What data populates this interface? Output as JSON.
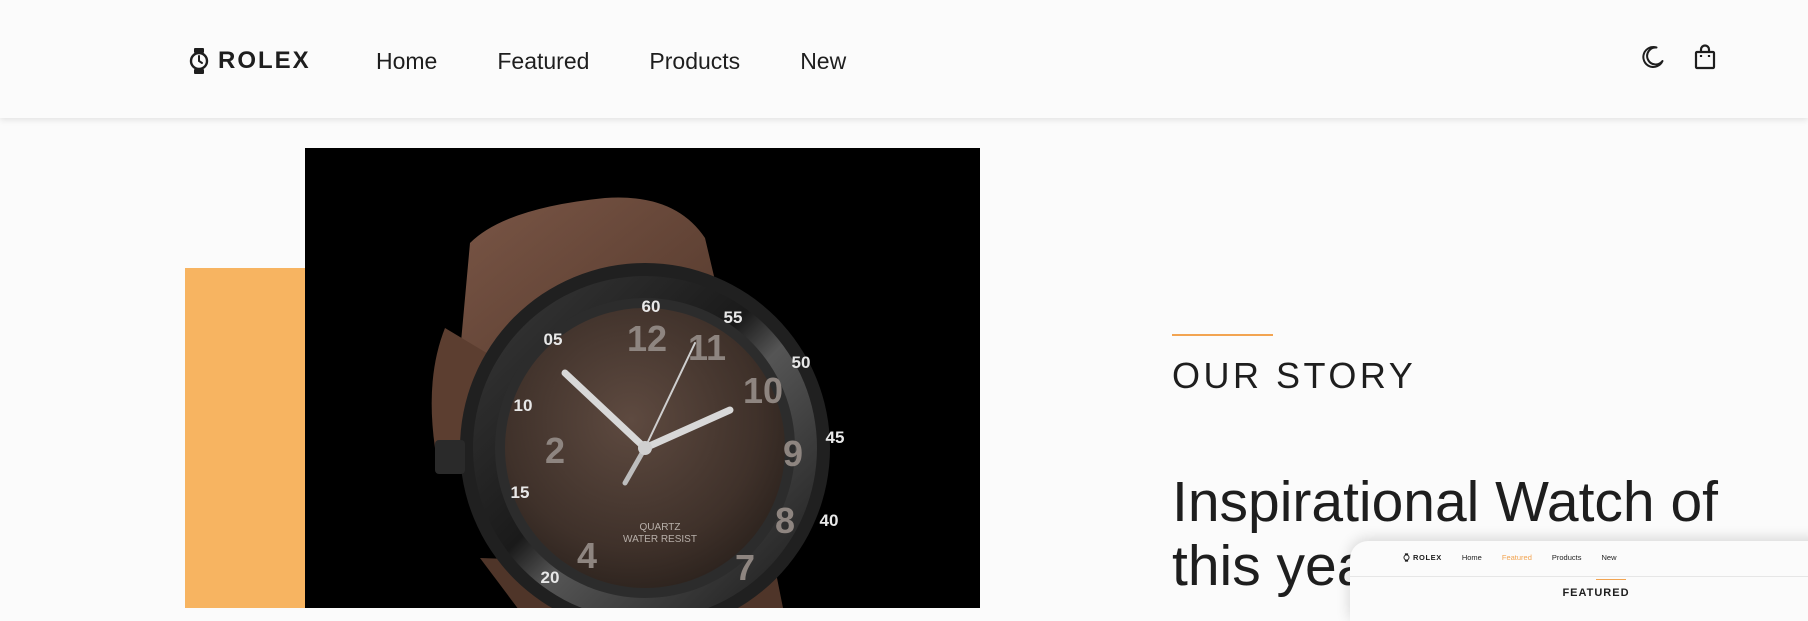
{
  "header": {
    "brand_label": "ROLEX",
    "brand_icon": "watch-icon",
    "nav": [
      "Home",
      "Featured",
      "Products",
      "New"
    ],
    "theme_icon": "moon-icon",
    "cart_icon": "shopping-bag-icon"
  },
  "hero": {
    "image_icon": "wristwatch-photo",
    "accent_color": "#f7b461"
  },
  "story": {
    "kicker": "OUR STORY",
    "title": "Inspirational Watch of this yea",
    "accent_color": "#f2a451"
  },
  "preview": {
    "brand_label": "ROLEX",
    "nav": [
      "Home",
      "Featured",
      "Products",
      "New"
    ],
    "active_color": "#f2a451",
    "section_label": "FEATURED"
  }
}
